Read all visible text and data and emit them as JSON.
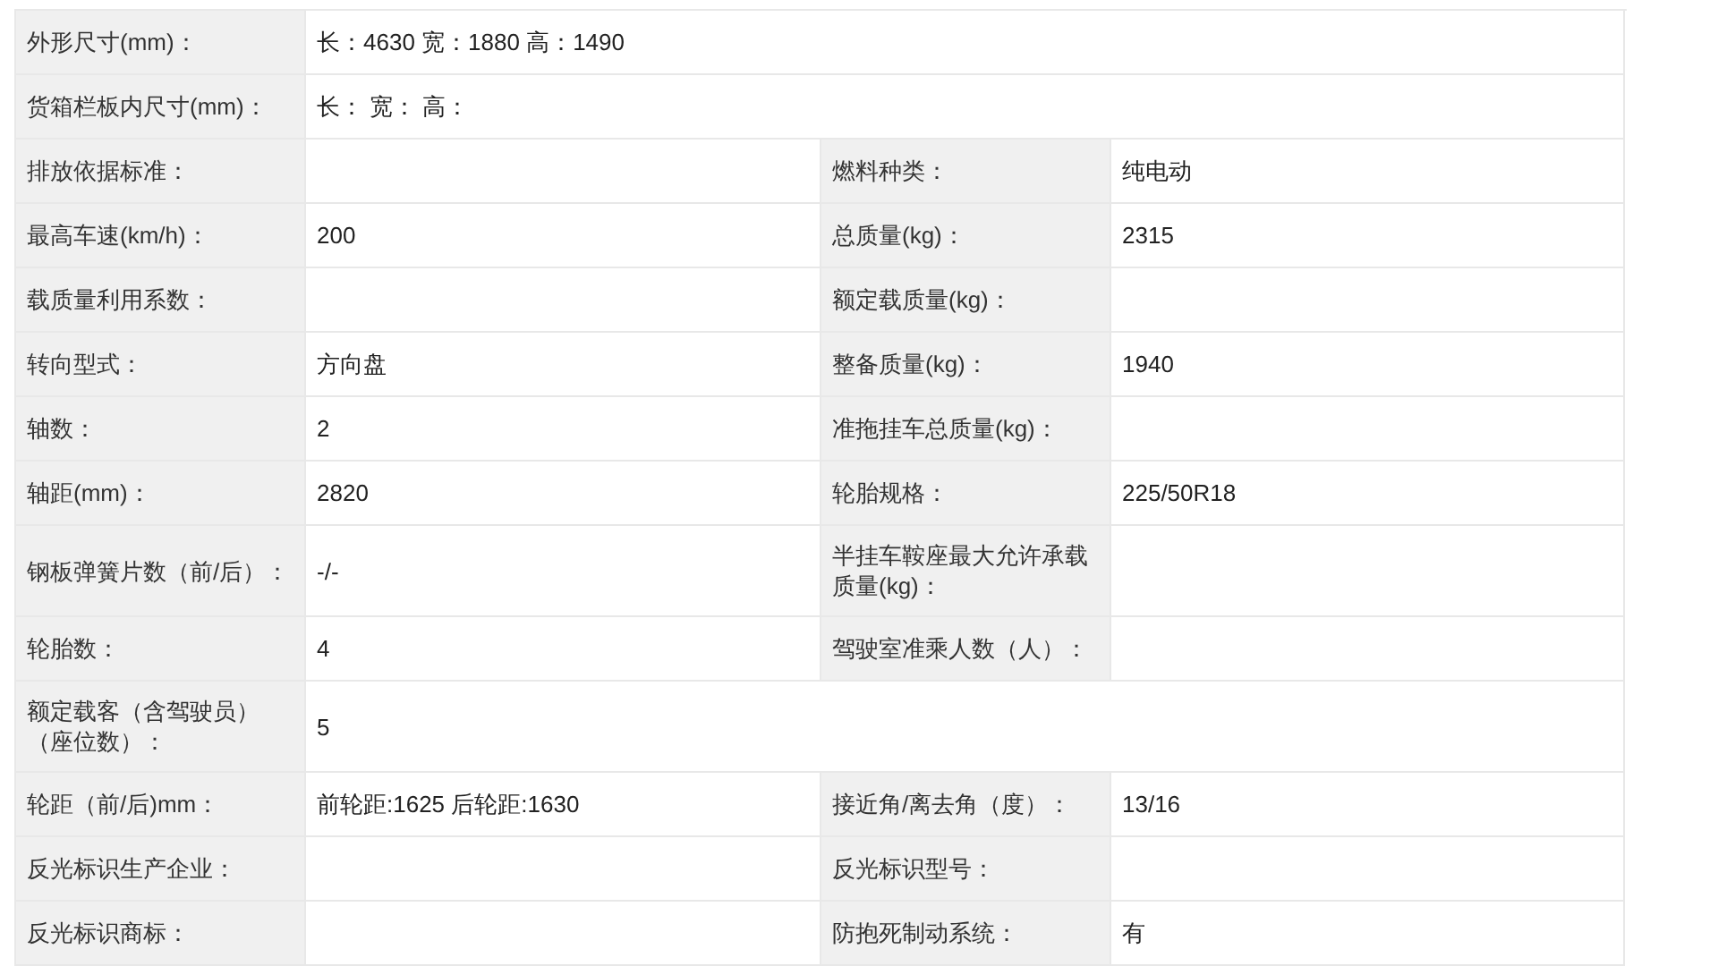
{
  "rows": [
    {
      "kind": "wide",
      "label": "外形尺寸(mm)：",
      "value": "长：4630 宽：1880 高：1490"
    },
    {
      "kind": "wide",
      "label": "货箱栏板内尺寸(mm)：",
      "value": "长： 宽： 高："
    },
    {
      "kind": "pair",
      "label": "排放依据标准：",
      "label_2": "燃料种类：",
      "value_2": "纯电动"
    },
    {
      "kind": "pair",
      "label": "最高车速(km/h)：",
      "value": "200",
      "label_2": "总质量(kg)：",
      "value_2": "2315"
    },
    {
      "kind": "pair",
      "label": "载质量利用系数：",
      "label_2": "额定载质量(kg)："
    },
    {
      "kind": "pair",
      "label": "转向型式：",
      "value": "方向盘",
      "label_2": "整备质量(kg)：",
      "value_2": "1940"
    },
    {
      "kind": "pair",
      "label": "轴数：",
      "value": "2",
      "label_2": "准拖挂车总质量(kg)："
    },
    {
      "kind": "pair",
      "label": "轴距(mm)：",
      "value": "2820",
      "label_2": "轮胎规格：",
      "value_2": "225/50R18"
    },
    {
      "kind": "pair",
      "label": "钢板弹簧片数（前/后）：",
      "value": "-/-",
      "label_2": "半挂车鞍座最大允许承载质量(kg)："
    },
    {
      "kind": "pair",
      "label": "轮胎数：",
      "value": "4",
      "label_2": "驾驶室准乘人数（人）："
    },
    {
      "kind": "wide",
      "label": "额定载客（含驾驶员）（座位数）：",
      "value": "5"
    },
    {
      "kind": "pair",
      "label": "轮距（前/后)mm：",
      "value": "前轮距:1625 后轮距:1630",
      "label_2": "接近角/离去角（度）：",
      "value_2": "13/16"
    },
    {
      "kind": "pair",
      "label": "反光标识生产企业：",
      "label_2": "反光标识型号："
    },
    {
      "kind": "pair",
      "label": "反光标识商标：",
      "label_2": "防抱死制动系统：",
      "value_2": "有"
    }
  ]
}
